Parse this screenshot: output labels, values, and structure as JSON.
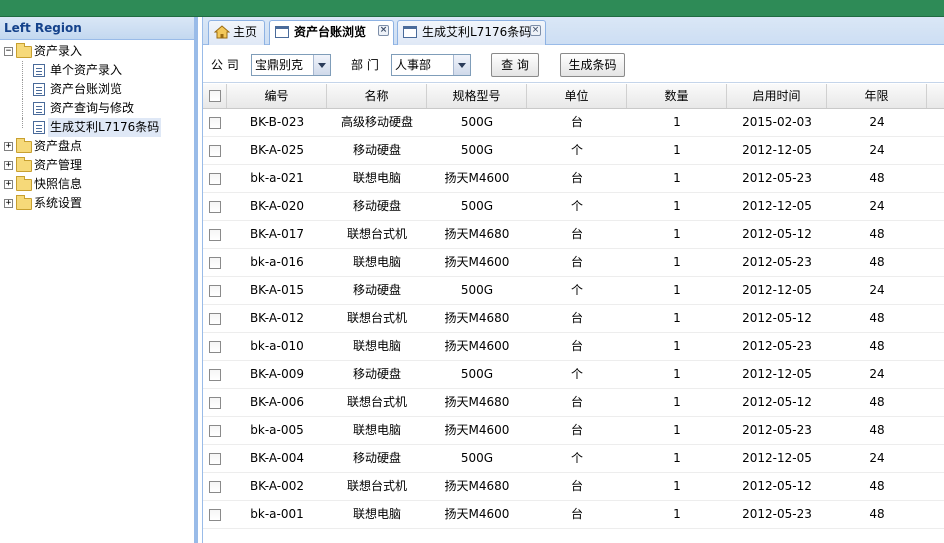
{
  "left": {
    "title": "Left Region",
    "tree": [
      {
        "label": "资产录入",
        "type": "folder",
        "expanded": true,
        "children": [
          {
            "label": "单个资产录入"
          },
          {
            "label": "资产台账浏览"
          },
          {
            "label": "资产查询与修改"
          },
          {
            "label": "生成艾利L7176条码",
            "selected": true
          }
        ]
      },
      {
        "label": "资产盘点",
        "type": "folder"
      },
      {
        "label": "资产管理",
        "type": "folder"
      },
      {
        "label": "快照信息",
        "type": "folder"
      },
      {
        "label": "系统设置",
        "type": "folder"
      }
    ]
  },
  "tabs": [
    {
      "label": "主页",
      "icon": "home-icon"
    },
    {
      "label": "资产台账浏览",
      "icon": "window-icon",
      "active": true
    },
    {
      "label": "生成艾利L7176条码",
      "icon": "window-icon"
    }
  ],
  "toolbar": {
    "company_label": "公 司",
    "company_value": "宝鼎别克",
    "dept_label": "部 门",
    "dept_value": "人事部",
    "query_label": "查 询",
    "generate_label": "生成条码"
  },
  "grid": {
    "columns": [
      "编号",
      "名称",
      "规格型号",
      "单位",
      "数量",
      "启用时间",
      "年限"
    ],
    "rows": [
      [
        "BK-B-023",
        "高级移动硬盘",
        "500G",
        "台",
        "1",
        "2015-02-03",
        "24"
      ],
      [
        "BK-A-025",
        "移动硬盘",
        "500G",
        "个",
        "1",
        "2012-12-05",
        "24"
      ],
      [
        "bk-a-021",
        "联想电脑",
        "扬天M4600",
        "台",
        "1",
        "2012-05-23",
        "48"
      ],
      [
        "BK-A-020",
        "移动硬盘",
        "500G",
        "个",
        "1",
        "2012-12-05",
        "24"
      ],
      [
        "BK-A-017",
        "联想台式机",
        "扬天M4680",
        "台",
        "1",
        "2012-05-12",
        "48"
      ],
      [
        "bk-a-016",
        "联想电脑",
        "扬天M4600",
        "台",
        "1",
        "2012-05-23",
        "48"
      ],
      [
        "BK-A-015",
        "移动硬盘",
        "500G",
        "个",
        "1",
        "2012-12-05",
        "24"
      ],
      [
        "BK-A-012",
        "联想台式机",
        "扬天M4680",
        "台",
        "1",
        "2012-05-12",
        "48"
      ],
      [
        "bk-a-010",
        "联想电脑",
        "扬天M4600",
        "台",
        "1",
        "2012-05-23",
        "48"
      ],
      [
        "BK-A-009",
        "移动硬盘",
        "500G",
        "个",
        "1",
        "2012-12-05",
        "24"
      ],
      [
        "BK-A-006",
        "联想台式机",
        "扬天M4680",
        "台",
        "1",
        "2012-05-12",
        "48"
      ],
      [
        "bk-a-005",
        "联想电脑",
        "扬天M4600",
        "台",
        "1",
        "2012-05-23",
        "48"
      ],
      [
        "BK-A-004",
        "移动硬盘",
        "500G",
        "个",
        "1",
        "2012-12-05",
        "24"
      ],
      [
        "BK-A-002",
        "联想台式机",
        "扬天M4680",
        "台",
        "1",
        "2012-05-12",
        "48"
      ],
      [
        "bk-a-001",
        "联想电脑",
        "扬天M4600",
        "台",
        "1",
        "2012-05-23",
        "48"
      ]
    ]
  }
}
